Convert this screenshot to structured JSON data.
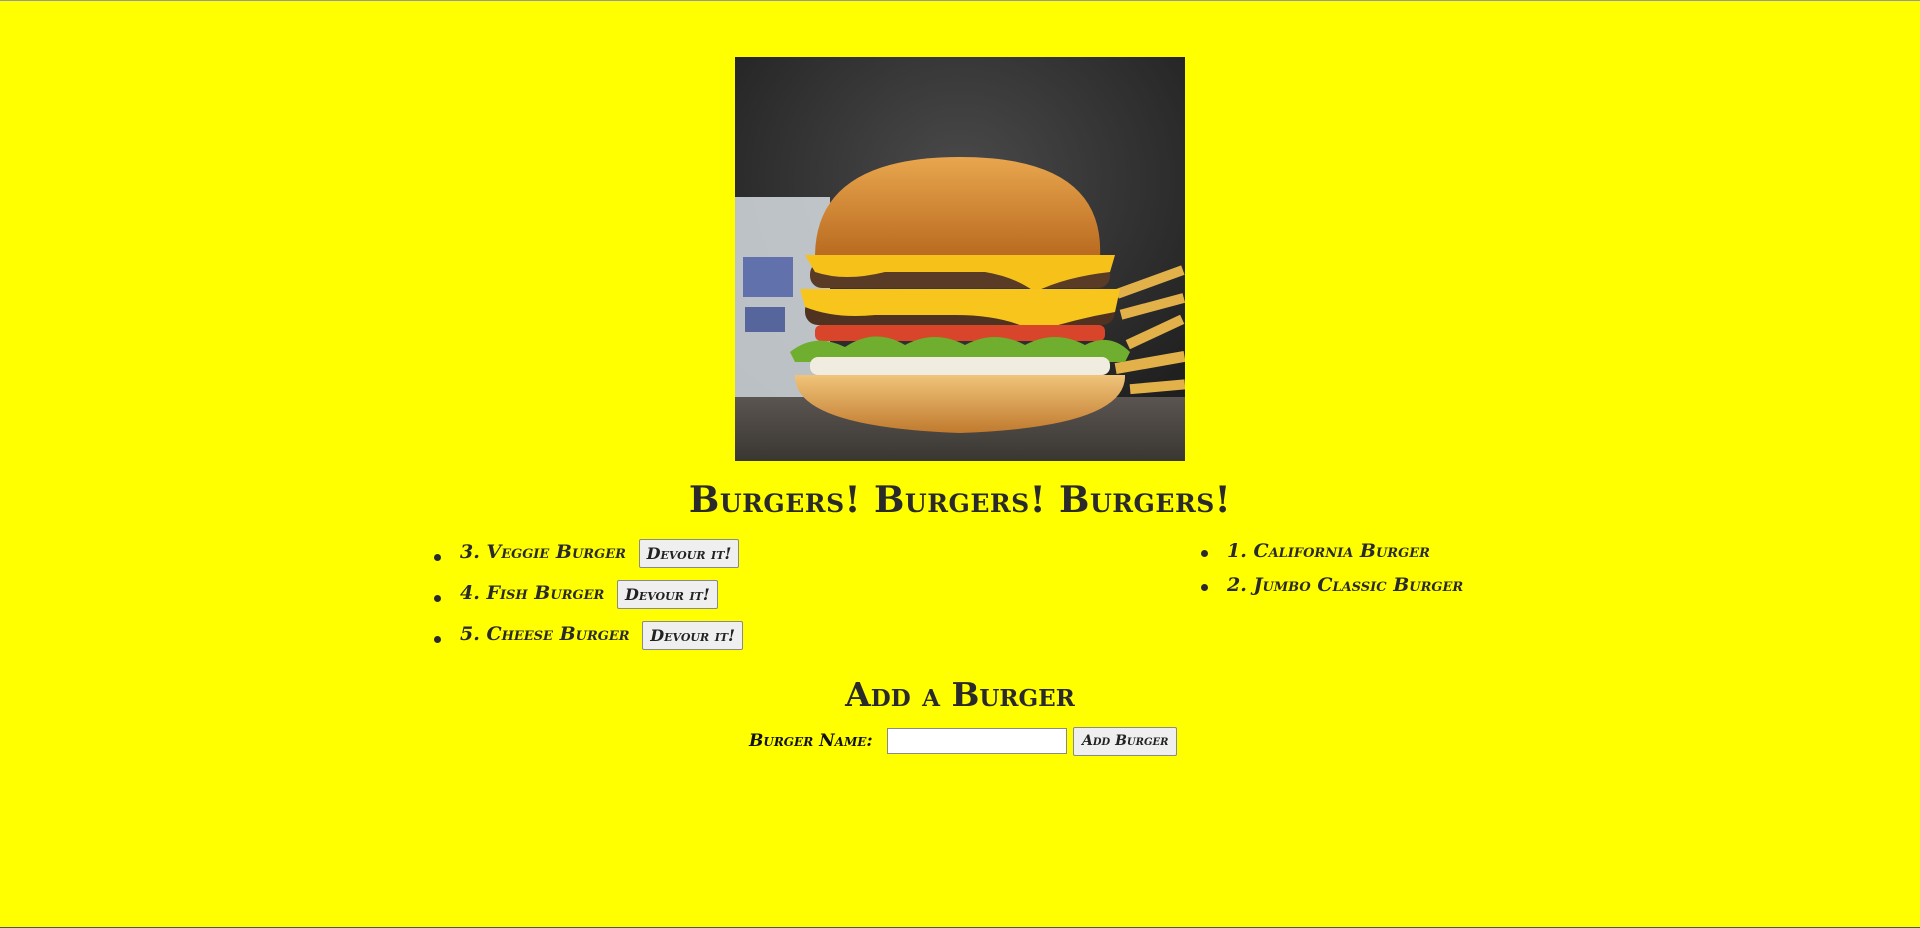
{
  "page": {
    "title": "Burgers! Burgers! Burgers!",
    "background_color": "#ffff00"
  },
  "hero_image": {
    "subject": "double cheeseburger with fries and drink"
  },
  "uneaten": {
    "items": [
      {
        "label": "3. Veggie Burger",
        "button": "Devour it!"
      },
      {
        "label": "4. Fish Burger",
        "button": "Devour it!"
      },
      {
        "label": "5. Cheese Burger",
        "button": "Devour it!"
      }
    ]
  },
  "devoured": {
    "items": [
      {
        "label": "1. California Burger"
      },
      {
        "label": "2. Jumbo Classic Burger"
      }
    ]
  },
  "add_form": {
    "heading": "Add a Burger",
    "field_label": "Burger Name:",
    "input_value": "",
    "submit_label": "Add Burger"
  }
}
